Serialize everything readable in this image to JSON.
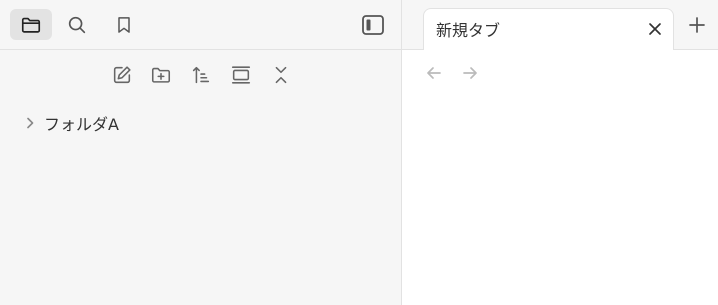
{
  "ribbon": {
    "icons": [
      "folder-icon",
      "search-icon",
      "bookmark-icon",
      "sidebar-toggle-icon"
    ]
  },
  "explorer": {
    "toolbar_icons": [
      "new-note-icon",
      "new-folder-icon",
      "sort-icon",
      "collapse-icon",
      "collapse-all-icon"
    ],
    "tree": [
      {
        "label": "フォルダA",
        "expanded": false
      }
    ]
  },
  "tabs": {
    "items": [
      {
        "title": "新規タブ",
        "active": true
      }
    ],
    "new_tab_icon": "plus-icon"
  },
  "navigation": {
    "back_icon": "arrow-left-icon",
    "forward_icon": "arrow-right-icon"
  }
}
